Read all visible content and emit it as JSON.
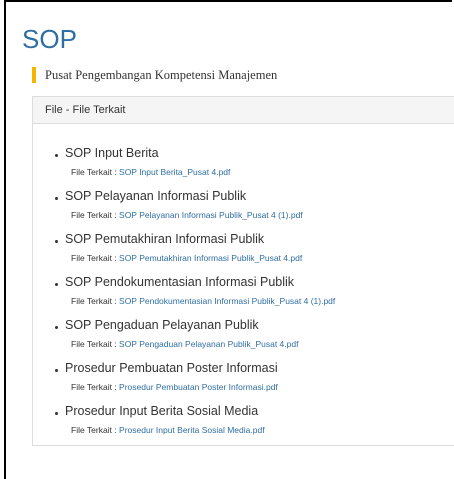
{
  "page": {
    "title": "SOP",
    "subtitle": "Pusat Pengembangan Kompetensi Manajemen",
    "accent_color": "#f4b400",
    "link_color": "#2f6ea3"
  },
  "panel": {
    "header": "File - File Terkait",
    "file_label": "File Terkait : ",
    "items": [
      {
        "title": "SOP Input Berita",
        "file": "SOP Input Berita_Pusat 4.pdf"
      },
      {
        "title": "SOP Pelayanan Informasi Publik",
        "file": "SOP Pelayanan Informasi Publik_Pusat 4 (1).pdf"
      },
      {
        "title": "SOP Pemutakhiran Informasi Publik",
        "file": "SOP Pemutakhiran Informasi Publik_Pusat 4.pdf"
      },
      {
        "title": "SOP Pendokumentasian Informasi Publik",
        "file": "SOP Pendokumentasian Informasi Publik_Pusat 4 (1).pdf"
      },
      {
        "title": "SOP Pengaduan Pelayanan Publik",
        "file": "SOP Pengaduan Pelayanan Publik_Pusat 4.pdf"
      },
      {
        "title": "Prosedur Pembuatan Poster Informasi",
        "file": "Prosedur Pembuatan Poster Informasi.pdf"
      },
      {
        "title": "Prosedur Input Berita Sosial Media",
        "file": "Prosedur Input Berita Sosial Media.pdf"
      }
    ]
  }
}
